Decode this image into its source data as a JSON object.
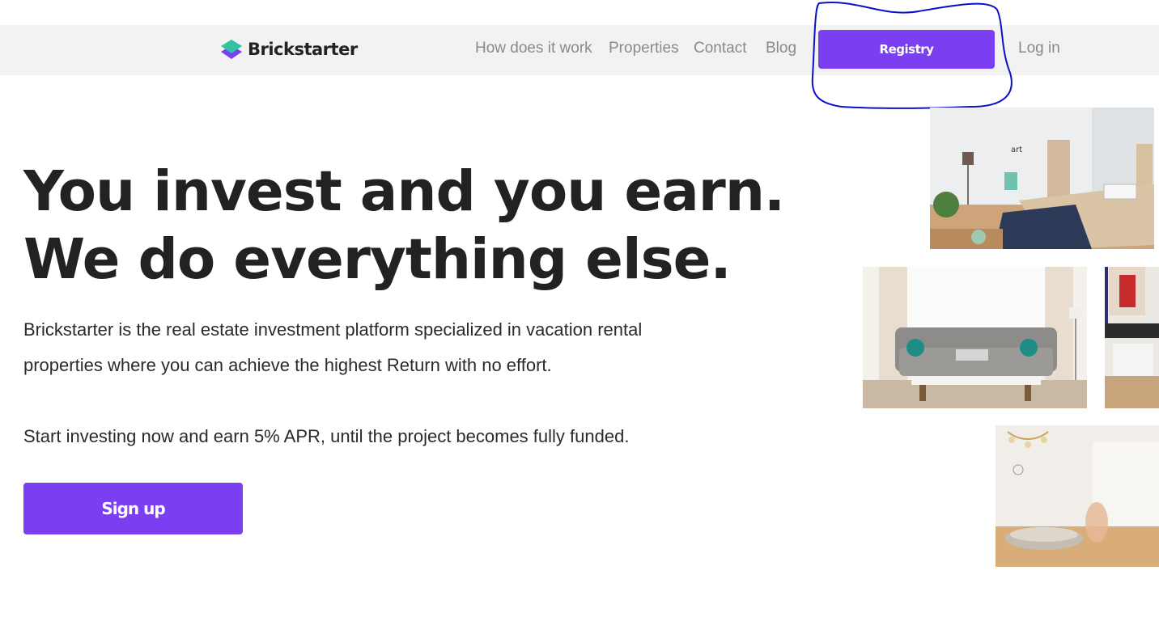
{
  "brand": {
    "name": "Brickstarter"
  },
  "nav": {
    "links": [
      "How does it work",
      "Properties",
      "Contact",
      "Blog"
    ],
    "registry_label": "Registry",
    "login_label": "Log in"
  },
  "hero": {
    "headline_line1": "You invest and you earn.",
    "headline_line2": "We do everything else.",
    "description": "Brickstarter is the real estate investment platform specialized in vacation rental properties where you can achieve the highest Return with no effort.",
    "cta_text": "Start investing now and earn 5% APR, until the project becomes fully funded.",
    "signup_label": "Sign up"
  },
  "colors": {
    "accent": "#7a3ff0",
    "nav_bg": "#f2f2f2",
    "nav_text": "#8a8a8a",
    "annotation": "#0a10c8"
  }
}
